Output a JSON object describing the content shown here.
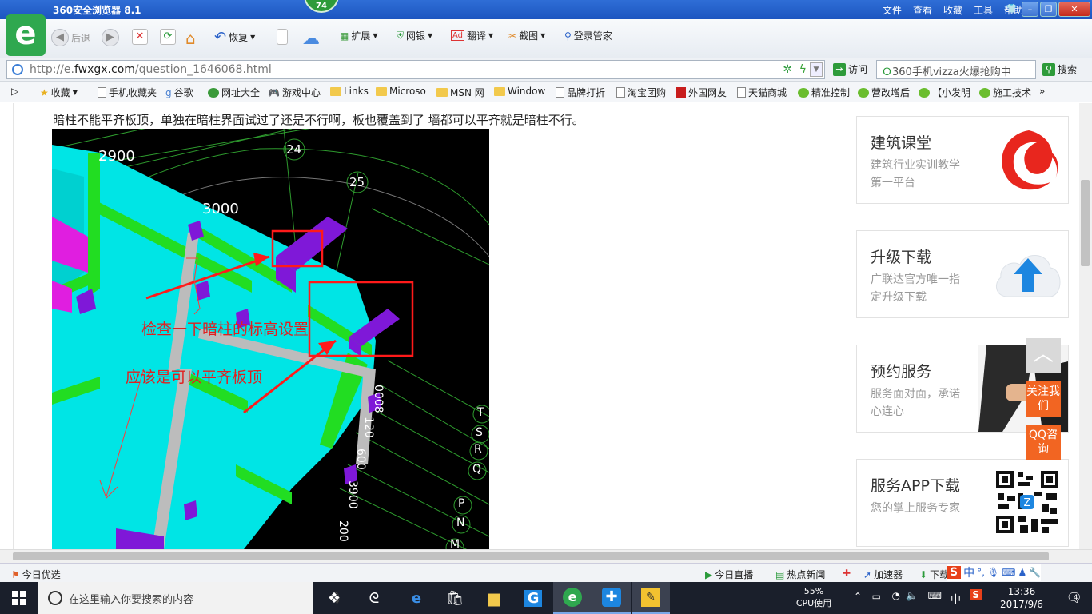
{
  "title_bar": {
    "title": "360安全浏览器 8.1",
    "badge": "74",
    "menu": [
      "文件",
      "查看",
      "收藏",
      "工具",
      "帮助"
    ]
  },
  "toolbar": {
    "back": "后退",
    "restore": "恢复",
    "extend": "扩展",
    "bank": "网银",
    "translate": "翻译",
    "screenshot": "截图",
    "login_manager": "登录管家"
  },
  "address": {
    "url_prefix": "http://e.",
    "url_domain": "fwxgx.com",
    "url_path": "/question_1646068.html",
    "visit": "访问",
    "search_value": "360手机vizza火爆抢购中",
    "search_button": "搜索"
  },
  "bookmarks": [
    "收藏",
    "手机收藏夹",
    "谷歌",
    "网址大全",
    "游戏中心",
    "Links",
    "Microso",
    "MSN 网",
    "Window",
    "品牌打折",
    "淘宝团购",
    "外国网友",
    "天猫商城",
    "精准控制",
    "营改增后",
    "【小发明",
    "施工技术"
  ],
  "content": {
    "question": "暗柱不能平齐板顶，单独在暗柱界面试过了还是不行啊，板也覆盖到了 墙都可以平齐就是暗柱不行。",
    "drawing": {
      "dims": [
        "2900",
        "3000"
      ],
      "axis_numbers": [
        "24",
        "25"
      ],
      "annotations": [
        "检查一下暗柱的标高设置",
        "应该是可以平齐板顶"
      ],
      "side_letters": [
        "T",
        "S",
        "R",
        "Q",
        "P",
        "N",
        "M"
      ],
      "vertical_dims": [
        "0008",
        "120",
        "600",
        "3900",
        "200"
      ]
    }
  },
  "sidebar": {
    "cards": [
      {
        "title": "建筑课堂",
        "desc": "建筑行业实训教学第一平台",
        "icon": "swirl-logo-icon"
      },
      {
        "title": "升级下载",
        "desc": "广联达官方唯一指定升级下载",
        "icon": "cloud-upload-icon"
      },
      {
        "title": "预约服务",
        "desc": "服务面对面，承诺心连心",
        "icon": "handshake-photo"
      },
      {
        "title": "服务APP下载",
        "desc": "您的掌上服务专家",
        "icon": "qr-code-icon"
      }
    ],
    "follow": "关注我们",
    "qq": "QQ咨询"
  },
  "status_bar": {
    "left": "今日优选",
    "items": [
      "今日直播",
      "热点新闻",
      "加速器",
      "下载"
    ]
  },
  "taskbar": {
    "search_placeholder": "在这里输入你要搜索的内容",
    "cpu_percent": "55%",
    "cpu_label": "CPU使用",
    "ime": "中",
    "time": "13:36",
    "date": "2017/9/6",
    "notifications": "4"
  },
  "colors": {
    "title_bar": "#1c55c0",
    "logo": "#2fa84f",
    "accent_orange": "#f26522",
    "annotation_red": "#e02020"
  }
}
